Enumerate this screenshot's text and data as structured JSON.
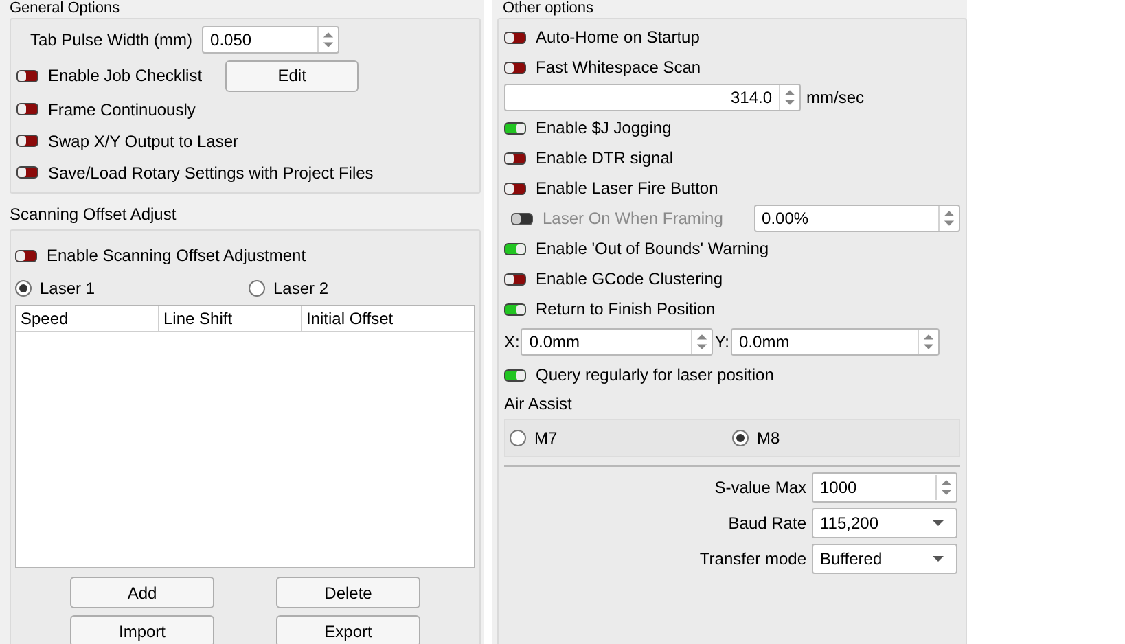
{
  "general_options": {
    "title": "General Options",
    "tab_pulse_width": {
      "label": "Tab Pulse Width (mm)",
      "value": "0.050"
    },
    "toggles": [
      {
        "label": "Enable Job Checklist",
        "on": false,
        "button": "Edit"
      },
      {
        "label": "Frame Continuously",
        "on": false
      },
      {
        "label": "Swap X/Y Output to Laser",
        "on": false
      },
      {
        "label": "Save/Load Rotary Settings with Project Files",
        "on": false
      }
    ]
  },
  "scanning_offset": {
    "title": "Scanning Offset Adjust",
    "toggle": {
      "label": "Enable Scanning Offset Adjustment",
      "on": false
    },
    "lasers": [
      {
        "label": "Laser 1",
        "selected": true
      },
      {
        "label": "Laser 2",
        "selected": false
      }
    ],
    "table": {
      "columns": [
        "Speed",
        "Line Shift",
        "Initial Offset"
      ]
    },
    "buttons": [
      "Add",
      "Delete",
      "Import",
      "Export"
    ]
  },
  "other_options": {
    "title": "Other options",
    "items": [
      {
        "kind": "toggle",
        "label": "Auto-Home on Startup",
        "on": false
      },
      {
        "kind": "toggle",
        "label": "Fast Whitespace Scan",
        "on": false
      },
      {
        "kind": "spin",
        "value": "314.0",
        "unit": "mm/sec"
      },
      {
        "kind": "toggle",
        "label": "Enable $J Jogging",
        "on": true
      },
      {
        "kind": "toggle",
        "label": "Enable DTR signal",
        "on": false
      },
      {
        "kind": "toggle",
        "label": "Enable Laser Fire Button",
        "on": false
      },
      {
        "kind": "toggle_field",
        "label": "Laser On When Framing",
        "on": false,
        "disabled": true,
        "value": "0.00%"
      },
      {
        "kind": "toggle",
        "label": "Enable 'Out of Bounds' Warning",
        "on": true
      },
      {
        "kind": "toggle",
        "label": "Enable GCode Clustering",
        "on": false
      },
      {
        "kind": "toggle",
        "label": "Return to Finish Position",
        "on": true
      },
      {
        "kind": "xy",
        "x_label": "X:",
        "x_value": "0.0mm",
        "y_label": "Y:",
        "y_value": "0.0mm"
      },
      {
        "kind": "toggle",
        "label": "Query regularly for laser position",
        "on": true
      },
      {
        "kind": "section_label",
        "label": "Air Assist"
      },
      {
        "kind": "radio_group",
        "options": [
          {
            "label": "M7",
            "selected": false
          },
          {
            "label": "M8",
            "selected": true
          }
        ]
      }
    ]
  },
  "form": [
    {
      "kind": "spin",
      "label": "S-value Max",
      "value": "1000"
    },
    {
      "kind": "combo",
      "label": "Baud Rate",
      "value": "115,200"
    },
    {
      "kind": "combo",
      "label": "Transfer mode",
      "value": "Buffered"
    }
  ]
}
